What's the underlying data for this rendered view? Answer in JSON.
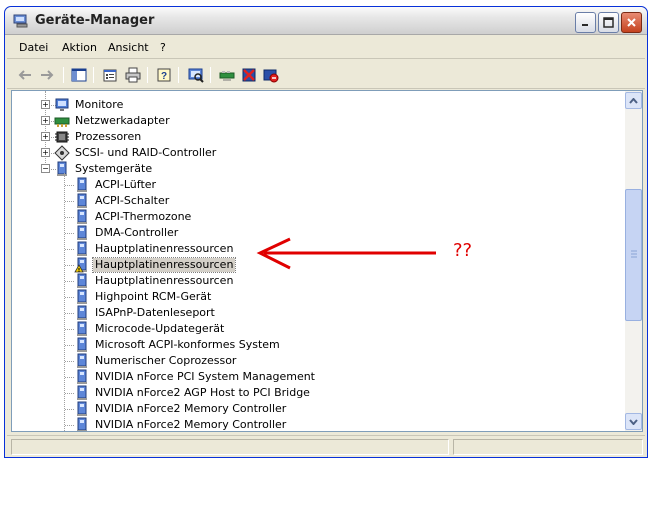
{
  "window": {
    "title": "Geräte-Manager",
    "icon": "computer-management-icon"
  },
  "menu": [
    "Datei",
    "Aktion",
    "Ansicht",
    "?"
  ],
  "toolbar": {
    "icons": [
      "back-arrow-icon",
      "forward-arrow-icon",
      "show-hide-console-tree-icon",
      "properties-icon",
      "print-icon",
      "help-icon",
      "scan-hardware-icon",
      "update-driver-icon",
      "uninstall-icon",
      "disable-icon"
    ]
  },
  "tree": {
    "categories": [
      {
        "label": "Monitore",
        "icon": "monitor-icon",
        "expanded": false
      },
      {
        "label": "Netzwerkadapter",
        "icon": "network-adapter-icon",
        "expanded": false
      },
      {
        "label": "Prozessoren",
        "icon": "processor-icon",
        "expanded": false
      },
      {
        "label": "SCSI- und RAID-Controller",
        "icon": "scsi-controller-icon",
        "expanded": false
      },
      {
        "label": "Systemgeräte",
        "icon": "system-device-icon",
        "expanded": true
      }
    ],
    "devices": [
      {
        "label": "ACPI-Lüfter"
      },
      {
        "label": "ACPI-Schalter"
      },
      {
        "label": "ACPI-Thermozone"
      },
      {
        "label": "DMA-Controller"
      },
      {
        "label": "Hauptplatinenressourcen"
      },
      {
        "label": "Hauptplatinenressourcen",
        "warning": true,
        "selected": true
      },
      {
        "label": "Hauptplatinenressourcen"
      },
      {
        "label": "Highpoint RCM-Gerät"
      },
      {
        "label": "ISAPnP-Datenleseport"
      },
      {
        "label": "Microcode-Updategerät"
      },
      {
        "label": "Microsoft ACPI-konformes System"
      },
      {
        "label": "Numerischer Coprozessor"
      },
      {
        "label": "NVIDIA nForce PCI System Management"
      },
      {
        "label": "NVIDIA nForce2 AGP Host to PCI Bridge"
      },
      {
        "label": "NVIDIA nForce2 Memory Controller"
      },
      {
        "label": "NVIDIA nForce2 Memory Controller"
      }
    ]
  },
  "annotation": {
    "text": "??",
    "color": "#e00000"
  }
}
